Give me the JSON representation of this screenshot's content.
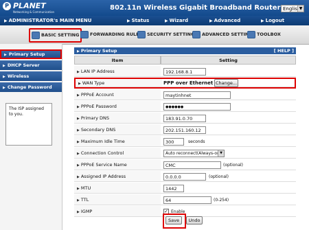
{
  "header": {
    "logo_text": "PLANET",
    "logo_sub": "Networking & Communication",
    "title": "802.11n Wireless Gigabit Broadband Router",
    "language": "English"
  },
  "menu": {
    "main": "ADMINISTRATOR's MAIN MENU",
    "status": "Status",
    "wizard": "Wizard",
    "advanced": "Advanced",
    "logout": "Logout"
  },
  "tabs": [
    {
      "label": "BASIC SETTING"
    },
    {
      "label": "FORWARDING RULES"
    },
    {
      "label": "SECURITY SETTING"
    },
    {
      "label": "ADVANCED SETTING"
    },
    {
      "label": "TOOLBOX"
    }
  ],
  "sidebar": {
    "items": [
      {
        "label": "Primary Setup"
      },
      {
        "label": "DHCP Server"
      },
      {
        "label": "Wireless"
      },
      {
        "label": "Change Password"
      }
    ],
    "help_text": "The ISP assigned to you."
  },
  "panel": {
    "title": "Primary Setup",
    "help": "[ HELP ]",
    "col_item": "Item",
    "col_setting": "Setting",
    "lan_ip_label": "LAN IP Address",
    "lan_ip_value": "192.168.8.1",
    "wan_type_label": "WAN Type",
    "wan_type_value": "PPP over Ethernet",
    "change_button": "Change...",
    "pppoe_account_label": "PPPoE Account",
    "pppoe_account_value": "maytinhnet",
    "pppoe_password_label": "PPPoE Password",
    "pppoe_password_value": "●●●●●●",
    "primary_dns_label": "Primary DNS",
    "primary_dns_value": "183.91.0.70",
    "secondary_dns_label": "Secondary DNS",
    "secondary_dns_value": "202.151.160.12",
    "max_idle_label": "Maximum Idle Time",
    "max_idle_value": "300",
    "max_idle_unit": "seconds",
    "conn_control_label": "Connection Control",
    "conn_control_value": "Auto reconnect(Always-on)",
    "service_name_label": "PPPoE Service Name",
    "service_name_value": "CMC",
    "optional": "(optional)",
    "assigned_ip_label": "Assigned IP Address",
    "assigned_ip_value": "0.0.0.0",
    "mtu_label": "MTU",
    "mtu_value": "1442",
    "ttl_label": "TTL",
    "ttl_value": "64",
    "ttl_range": "(0-254)",
    "igmp_label": "IGMP",
    "igmp_enable": "Enable",
    "save_button": "Save",
    "undo_button": "Undo"
  }
}
